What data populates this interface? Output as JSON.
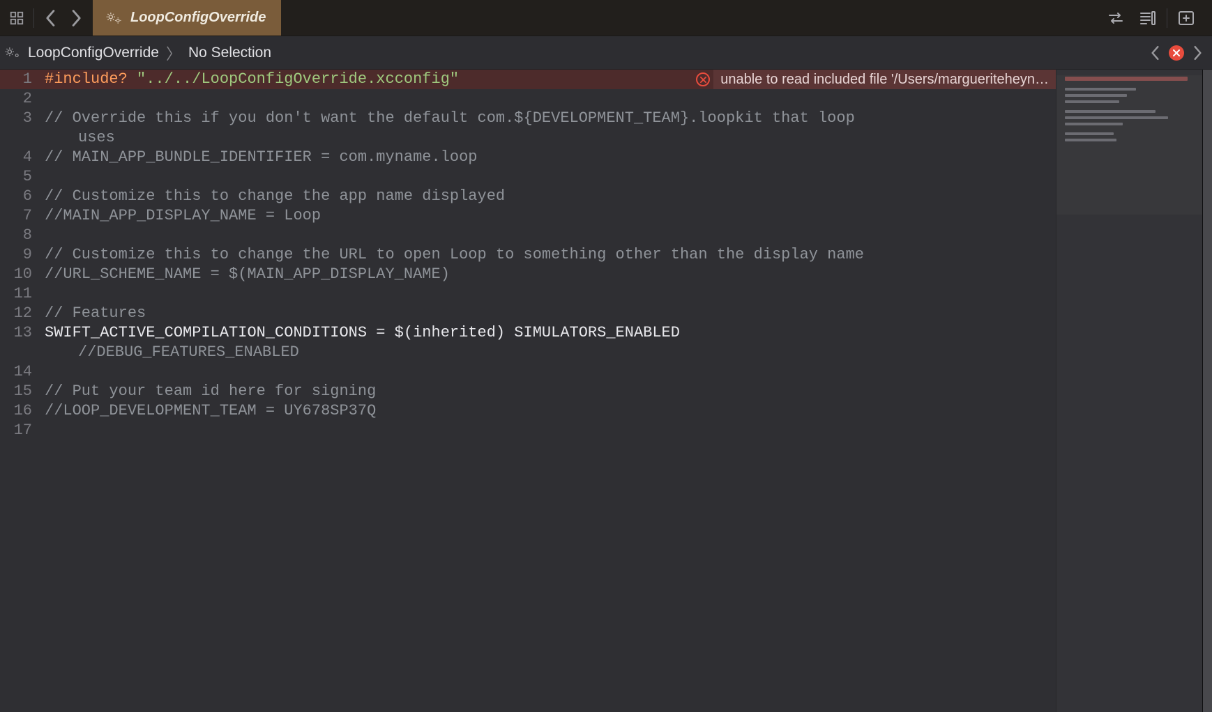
{
  "tab": {
    "title": "LoopConfigOverride"
  },
  "breadcrumb": {
    "file": "LoopConfigOverride",
    "selection": "No Selection"
  },
  "inline_error": {
    "message": "unable to read included file '/Users/margueriteheyn…"
  },
  "code": {
    "lines": [
      {
        "n": 1,
        "type": "error",
        "segments": [
          {
            "t": "#include?",
            "c": "orange"
          },
          {
            "t": " ",
            "c": "normal"
          },
          {
            "t": "\"../../LoopConfigOverride.xcconfig\"",
            "c": "green"
          }
        ]
      },
      {
        "n": 2,
        "type": "blank"
      },
      {
        "n": 3,
        "type": "comment",
        "text": "// Override this if you don't want the default com.${DEVELOPMENT_TEAM}.loopkit that loop",
        "wrap": "uses"
      },
      {
        "n": 4,
        "type": "comment",
        "text": "// MAIN_APP_BUNDLE_IDENTIFIER = com.myname.loop"
      },
      {
        "n": 5,
        "type": "blank"
      },
      {
        "n": 6,
        "type": "comment",
        "text": "// Customize this to change the app name displayed"
      },
      {
        "n": 7,
        "type": "comment",
        "text": "//MAIN_APP_DISPLAY_NAME = Loop"
      },
      {
        "n": 8,
        "type": "blank"
      },
      {
        "n": 9,
        "type": "comment",
        "text": "// Customize this to change the URL to open Loop to something other than the display name"
      },
      {
        "n": 10,
        "type": "comment",
        "text": "//URL_SCHEME_NAME = $(MAIN_APP_DISPLAY_NAME)"
      },
      {
        "n": 11,
        "type": "blank"
      },
      {
        "n": 12,
        "type": "comment",
        "text": "// Features"
      },
      {
        "n": 13,
        "type": "normal",
        "text": "SWIFT_ACTIVE_COMPILATION_CONDITIONS = $(inherited) SIMULATORS_ENABLED",
        "wrap_comment": "//DEBUG_FEATURES_ENABLED"
      },
      {
        "n": 14,
        "type": "blank"
      },
      {
        "n": 15,
        "type": "comment",
        "text": "// Put your team id here for signing"
      },
      {
        "n": 16,
        "type": "comment",
        "text": "//LOOP_DEVELOPMENT_TEAM = UY678SP37Q"
      },
      {
        "n": 17,
        "type": "blank"
      }
    ]
  },
  "icons": {
    "grid": "grid-icon",
    "back": "chevron-left-icon",
    "forward": "chevron-right-icon",
    "gears": "gears-icon",
    "swap": "swap-icon",
    "lines": "code-review-icon",
    "add_panel": "add-panel-icon",
    "error": "error-icon"
  }
}
